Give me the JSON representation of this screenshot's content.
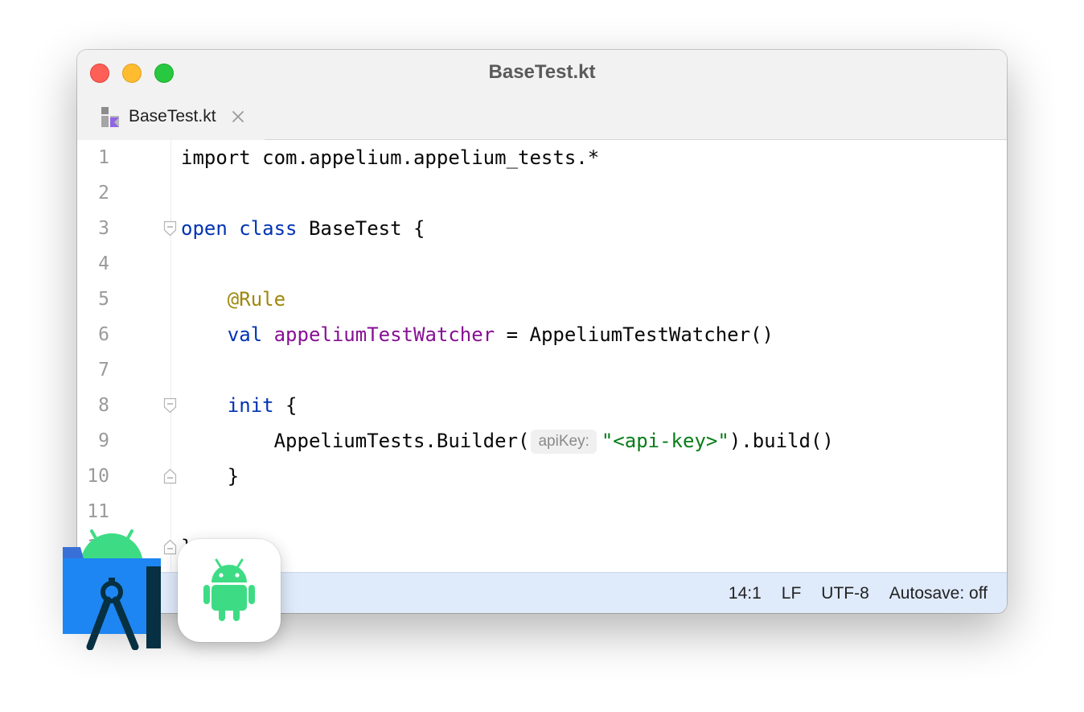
{
  "window": {
    "title": "BaseTest.kt"
  },
  "tabs": [
    {
      "label": "BaseTest.kt",
      "icon": "kotlin-file-icon"
    }
  ],
  "editor": {
    "lines": [
      {
        "num": "1",
        "tokens": [
          {
            "t": "import com.appelium.appelium_tests.*",
            "c": "plain"
          }
        ]
      },
      {
        "num": "2",
        "tokens": []
      },
      {
        "num": "3",
        "fold": "start",
        "tokens": [
          {
            "t": "open",
            "c": "kw"
          },
          {
            "t": " ",
            "c": "plain"
          },
          {
            "t": "class",
            "c": "kw"
          },
          {
            "t": " BaseTest {",
            "c": "plain"
          }
        ]
      },
      {
        "num": "4",
        "tokens": []
      },
      {
        "num": "5",
        "tokens": [
          {
            "t": "    ",
            "c": "plain"
          },
          {
            "t": "@Rule",
            "c": "ann"
          }
        ]
      },
      {
        "num": "6",
        "tokens": [
          {
            "t": "    ",
            "c": "plain"
          },
          {
            "t": "val",
            "c": "kw"
          },
          {
            "t": " ",
            "c": "plain"
          },
          {
            "t": "appeliumTestWatcher",
            "c": "prop"
          },
          {
            "t": " = AppeliumTestWatcher()",
            "c": "plain"
          }
        ]
      },
      {
        "num": "7",
        "tokens": []
      },
      {
        "num": "8",
        "fold": "start",
        "tokens": [
          {
            "t": "    ",
            "c": "plain"
          },
          {
            "t": "init",
            "c": "kw"
          },
          {
            "t": " {",
            "c": "plain"
          }
        ]
      },
      {
        "num": "9",
        "tokens": [
          {
            "t": "        AppeliumTests.Builder(",
            "c": "plain"
          },
          {
            "t": "apiKey:",
            "c": "hint"
          },
          {
            "t": "\"<api-key>\"",
            "c": "str"
          },
          {
            "t": ").build()",
            "c": "plain"
          }
        ]
      },
      {
        "num": "10",
        "fold": "end",
        "tokens": [
          {
            "t": "    }",
            "c": "plain"
          }
        ]
      },
      {
        "num": "11",
        "tokens": []
      },
      {
        "num": "12",
        "fold": "end",
        "tokens": [
          {
            "t": "}",
            "c": "plain"
          }
        ]
      }
    ]
  },
  "statusbar": {
    "position": "14:1",
    "line_ending": "LF",
    "encoding": "UTF-8",
    "autosave": "Autosave: off"
  },
  "colors": {
    "keyword": "#0033b3",
    "annotation": "#9e880d",
    "property": "#871094",
    "string": "#067d17",
    "android_green": "#3ddc84"
  },
  "overlay_icons": [
    "android-studio-icon",
    "android-app-icon"
  ]
}
